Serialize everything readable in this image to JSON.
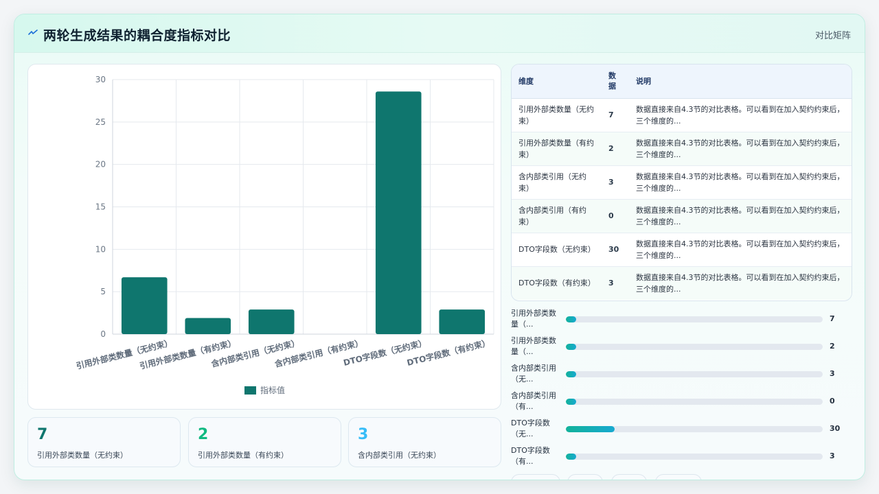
{
  "header": {
    "title": "两轮生成结果的耦合度指标对比",
    "mode": "对比矩阵"
  },
  "chart_data": {
    "type": "bar",
    "categories": [
      "引用外部类数量（无约束）",
      "引用外部类数量（有约束）",
      "含内部类引用（无约束）",
      "含内部类引用（有约束）",
      "DTO字段数（无约束）",
      "DTO字段数（有约束）"
    ],
    "series": [
      {
        "name": "指标值",
        "values": [
          6.7,
          1.9,
          2.9,
          0,
          28.6,
          2.9
        ]
      }
    ],
    "ylim": [
      0,
      30
    ],
    "yticks": [
      0,
      5,
      10,
      15,
      20,
      25,
      30
    ],
    "legend": "bottom",
    "grid": true,
    "bar_color": "#0f766e"
  },
  "stats": [
    {
      "value": "7",
      "label": "引用外部类数量（无约束）",
      "color": "#0f766e"
    },
    {
      "value": "2",
      "label": "引用外部类数量（有约束）",
      "color": "#10b981"
    },
    {
      "value": "3",
      "label": "含内部类引用（无约束）",
      "color": "#38bdf8"
    }
  ],
  "table": {
    "headers": {
      "dim": "维度",
      "data": "数据",
      "desc": "说明"
    },
    "rows": [
      {
        "dim": "引用外部类数量（无约束）",
        "data": "7",
        "desc": "数据直接来自4.3节的对比表格。可以看到在加入契约约束后，三个维度的..."
      },
      {
        "dim": "引用外部类数量（有约束）",
        "data": "2",
        "desc": "数据直接来自4.3节的对比表格。可以看到在加入契约约束后，三个维度的..."
      },
      {
        "dim": "含内部类引用（无约束）",
        "data": "3",
        "desc": "数据直接来自4.3节的对比表格。可以看到在加入契约约束后，三个维度的..."
      },
      {
        "dim": "含内部类引用（有约束）",
        "data": "0",
        "desc": "数据直接来自4.3节的对比表格。可以看到在加入契约约束后，三个维度的..."
      },
      {
        "dim": "DTO字段数（无约束）",
        "data": "30",
        "desc": "数据直接来自4.3节的对比表格。可以看到在加入契约约束后，三个维度的..."
      },
      {
        "dim": "DTO字段数（有约束）",
        "data": "3",
        "desc": "数据直接来自4.3节的对比表格。可以看到在加入契约约束后，三个维度的..."
      }
    ]
  },
  "progress": [
    {
      "label": "引用外部类数量（...",
      "value": "7",
      "fraction": 0.04
    },
    {
      "label": "引用外部类数量（...",
      "value": "2",
      "fraction": 0.04
    },
    {
      "label": "含内部类引用（无...",
      "value": "3",
      "fraction": 0.04
    },
    {
      "label": "含内部类引用（有...",
      "value": "0",
      "fraction": 0.04
    },
    {
      "label": "DTO字段数（无...",
      "value": "30",
      "fraction": 0.19
    },
    {
      "label": "DTO字段数（有...",
      "value": "3",
      "fraction": 0.04
    }
  ]
}
